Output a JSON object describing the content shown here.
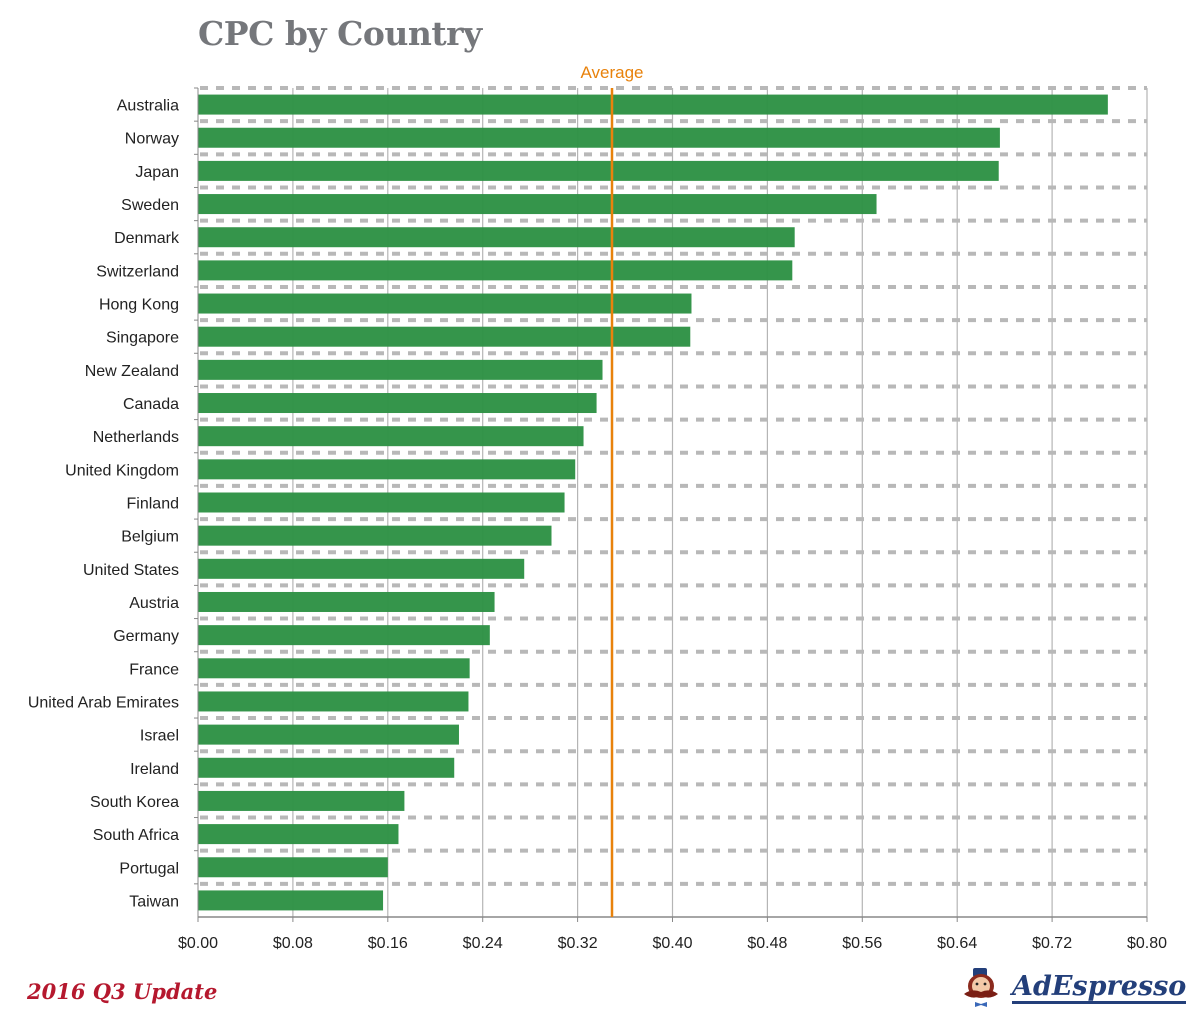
{
  "footer": {
    "update_label": "2016 Q3 Update",
    "brand_name": "AdEspresso",
    "brand_icon": "mustache-mascot-icon"
  },
  "colors": {
    "bar": "#2e9245",
    "average_line": "#e8820c",
    "title": "#75777b",
    "grid": "#b8b8b8",
    "update_label": "#b5182e",
    "brand": "#233f7a"
  },
  "chart_data": {
    "type": "bar",
    "orientation": "horizontal",
    "title": "CPC by Country",
    "xlabel": "",
    "ylabel": "",
    "xlim": [
      0,
      0.8
    ],
    "x_ticks": [
      0.0,
      0.08,
      0.16,
      0.24,
      0.32,
      0.4,
      0.48,
      0.56,
      0.64,
      0.72,
      0.8
    ],
    "x_tick_labels": [
      "$0.00",
      "$0.08",
      "$0.16",
      "$0.24",
      "$0.32",
      "$0.40",
      "$0.48",
      "$0.56",
      "$0.64",
      "$0.72",
      "$0.80"
    ],
    "grid": true,
    "categories": [
      "Australia",
      "Norway",
      "Japan",
      "Sweden",
      "Denmark",
      "Switzerland",
      "Hong Kong",
      "Singapore",
      "New Zealand",
      "Canada",
      "Netherlands",
      "United Kingdom",
      "Finland",
      "Belgium",
      "United States",
      "Austria",
      "Germany",
      "France",
      "United Arab Emirates",
      "Israel",
      "Ireland",
      "South Korea",
      "South Africa",
      "Portugal",
      "Taiwan"
    ],
    "values": [
      0.767,
      0.676,
      0.675,
      0.572,
      0.503,
      0.501,
      0.416,
      0.415,
      0.341,
      0.336,
      0.325,
      0.318,
      0.309,
      0.298,
      0.275,
      0.25,
      0.246,
      0.229,
      0.228,
      0.22,
      0.216,
      0.174,
      0.169,
      0.16,
      0.156
    ],
    "reference_line": {
      "label": "Average",
      "value": 0.349
    }
  }
}
